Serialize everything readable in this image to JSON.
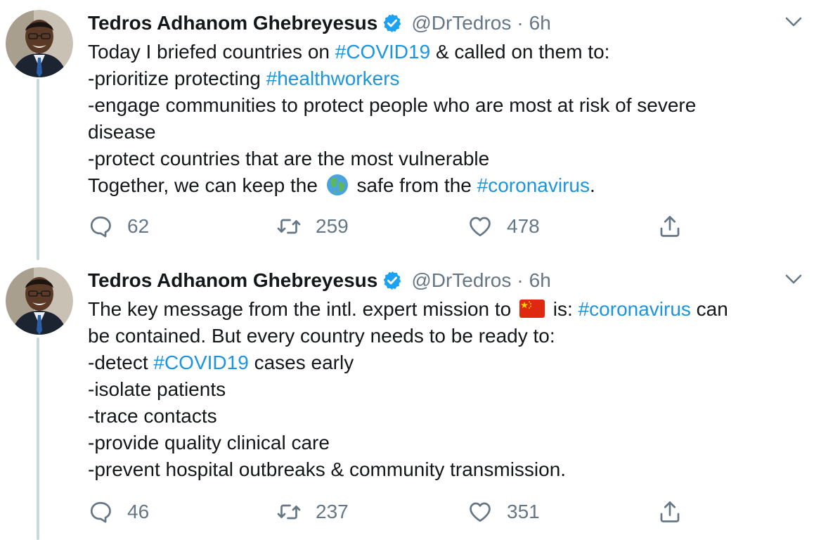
{
  "tweets": [
    {
      "author": "Tedros Adhanom Ghebreyesus",
      "handle": "@DrTedros",
      "separator": "·",
      "time": "6h",
      "body": {
        "l1a": "Today I briefed countries on ",
        "l1b": "#COVID19",
        "l1c": " & called on them to:",
        "l2a": "-prioritize protecting ",
        "l2b": "#healthworkers",
        "l3": "-engage communities to protect people who are most at risk of severe",
        "l4": "disease",
        "l5": "-protect countries that are the most vulnerable",
        "l6a": "Together, we can keep the ",
        "l6b": " safe from the ",
        "l6c": "#coronavirus",
        "l6d": "."
      },
      "stats": {
        "replies": "62",
        "retweets": "259",
        "likes": "478"
      }
    },
    {
      "author": "Tedros Adhanom Ghebreyesus",
      "handle": "@DrTedros",
      "separator": "·",
      "time": "6h",
      "body": {
        "l1a": "The key message from the intl. expert mission to ",
        "l1b": " is: ",
        "l1c": "#coronavirus",
        "l1d": " can",
        "l2": "be contained. But every country needs to be ready to:",
        "l3a": "-detect ",
        "l3b": "#COVID19",
        "l3c": " cases early",
        "l4": "-isolate patients",
        "l5": "-trace contacts",
        "l6": "-provide quality clinical care",
        "l7": "-prevent hospital outbreaks & community transmission."
      },
      "stats": {
        "replies": "46",
        "retweets": "237",
        "likes": "351"
      }
    }
  ],
  "icons": {
    "verified": "verified-badge-icon",
    "more": "chevron-down-icon",
    "reply": "reply-icon",
    "retweet": "retweet-icon",
    "like": "heart-icon",
    "share": "share-icon",
    "globe": "globe-emoji-icon",
    "flag": "china-flag-emoji-icon"
  },
  "colors": {
    "hashtag": "#1b95e0",
    "verified": "#1da1f2",
    "secondary_text": "#657786",
    "thread_line": "#ccd6dd"
  }
}
